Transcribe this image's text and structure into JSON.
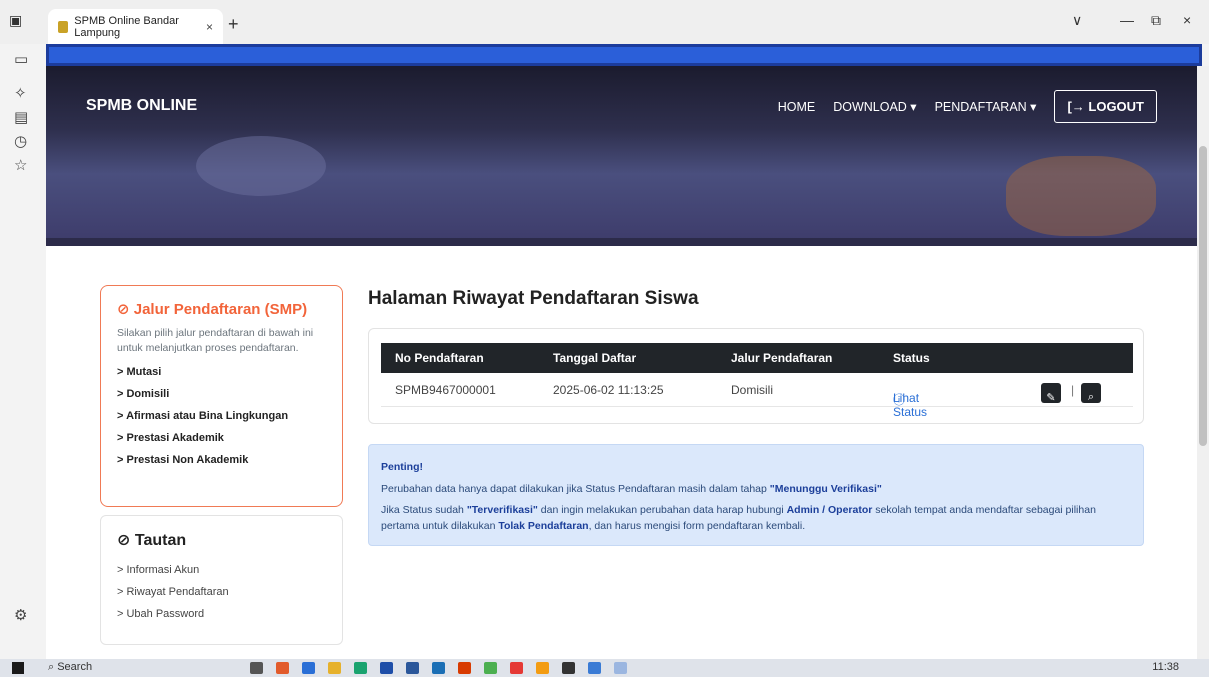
{
  "browser": {
    "tab_title": "SPMB Online Bandar Lampung",
    "tab_close": "×",
    "new_tab": "+",
    "minimize": "—",
    "restore": "⧉",
    "close": "×",
    "chevron": "∨"
  },
  "navbar": {
    "brand": "SPMB ONLINE",
    "home": "HOME",
    "download": "DOWNLOAD ▾",
    "pendaftaran": "PENDAFTARAN ▾",
    "logout": "[→ LOGOUT"
  },
  "jalur_card": {
    "title": "Jalur Pendaftaran (SMP)",
    "description": "Silakan pilih jalur pendaftaran di bawah ini untuk melanjutkan proses pendaftaran.",
    "items": [
      "Mutasi",
      "Domisili",
      "Afirmasi atau Bina Lingkungan",
      "Prestasi Akademik",
      "Prestasi Non Akademik"
    ]
  },
  "tautan_card": {
    "title": "Tautan",
    "items": [
      "Informasi Akun",
      "Riwayat Pendaftaran",
      "Ubah Password"
    ]
  },
  "main": {
    "title": "Halaman Riwayat Pendaftaran Siswa",
    "table": {
      "headers": [
        "No Pendaftaran",
        "Tanggal Daftar",
        "Jalur Pendaftaran",
        "Status"
      ],
      "row": {
        "no": "SPMB9467000001",
        "tanggal": "2025-06-02 11:13:25",
        "jalur": "Domisili",
        "status": "Lihat Status"
      }
    }
  },
  "alert": {
    "head": "Penting!",
    "line1_a": "Perubahan data hanya dapat dilakukan jika Status Pendaftaran masih dalam tahap ",
    "line1_b": "\"Menunggu Verifikasi\"",
    "line2_a": "Jika Status sudah ",
    "line2_b": "\"Terverifikasi\"",
    "line2_c": " dan ingin melakukan perubahan data harap hubungi ",
    "line2_d": "Admin / Operator",
    "line2_e": " sekolah tempat anda mendaftar sebagai pilihan pertama untuk dilakukan ",
    "line2_f": "Tolak Pendaftaran",
    "line2_g": ", dan harus mengisi form pendaftaran kembali."
  },
  "taskbar": {
    "search": "Search",
    "time": "11:38"
  }
}
